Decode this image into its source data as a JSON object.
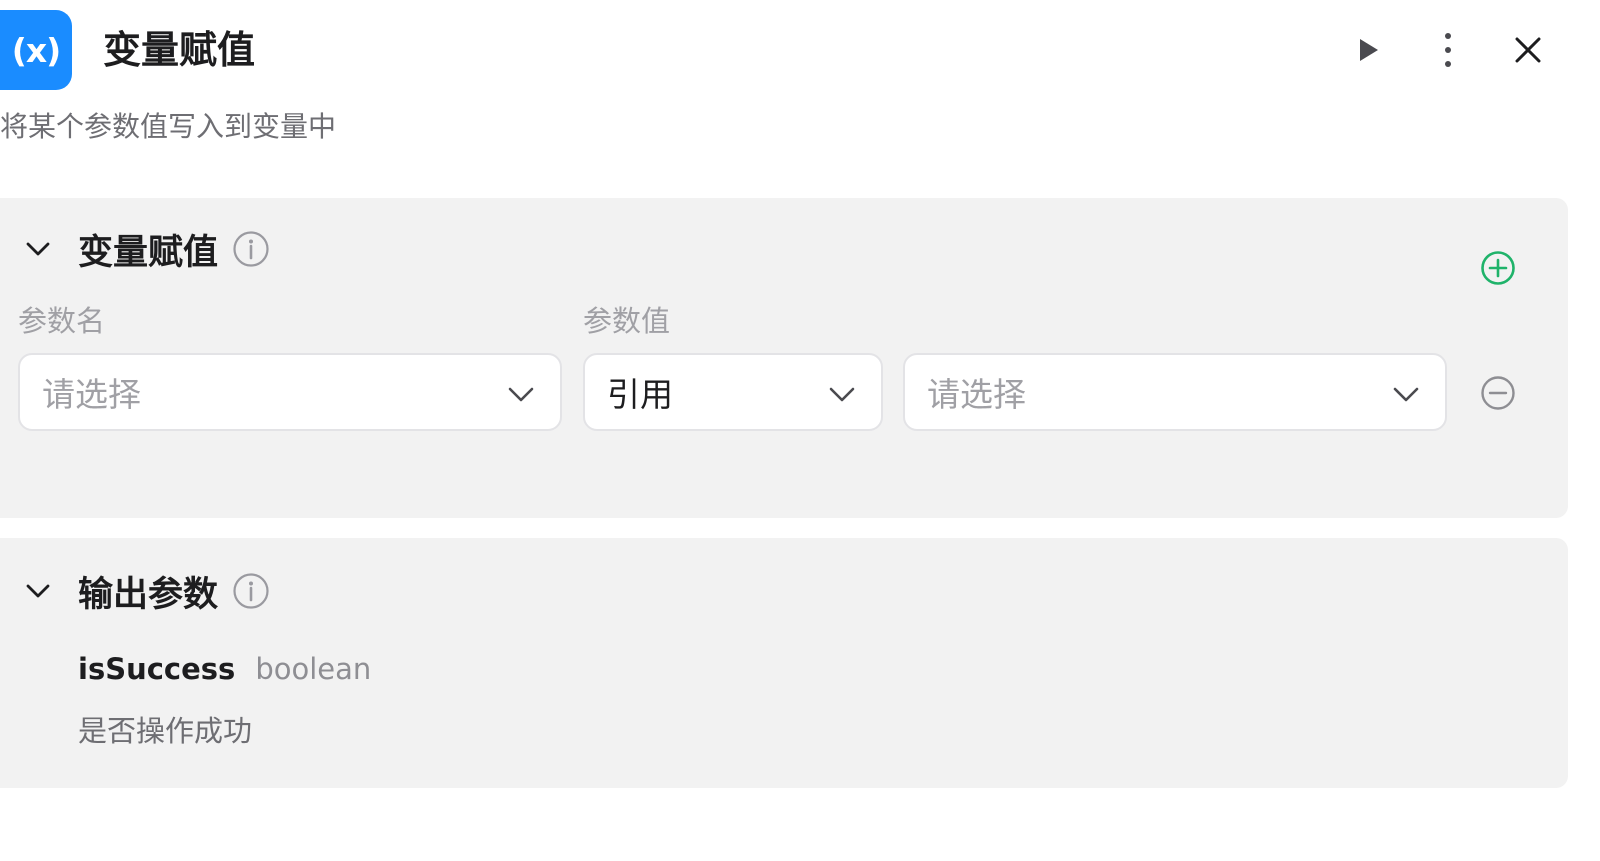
{
  "colors": {
    "accent": "#1a8cff",
    "add_green": "#1fb36a",
    "panel_bg": "#f2f2f2"
  },
  "header": {
    "icon_text": "(x)",
    "title": "变量赋值",
    "icons": [
      "play-icon",
      "more-vertical-icon",
      "close-icon"
    ]
  },
  "description": "将某个参数值写入到变量中",
  "assign_section": {
    "title": "变量赋值",
    "expanded": true,
    "columns": {
      "name": "参数名",
      "value": "参数值"
    },
    "row": {
      "name_placeholder": "请选择",
      "mode_value": "引用",
      "ref_placeholder": "请选择"
    }
  },
  "output_section": {
    "title": "输出参数",
    "expanded": true,
    "params": [
      {
        "name": "isSuccess",
        "type": "boolean",
        "description": "是否操作成功"
      }
    ]
  }
}
